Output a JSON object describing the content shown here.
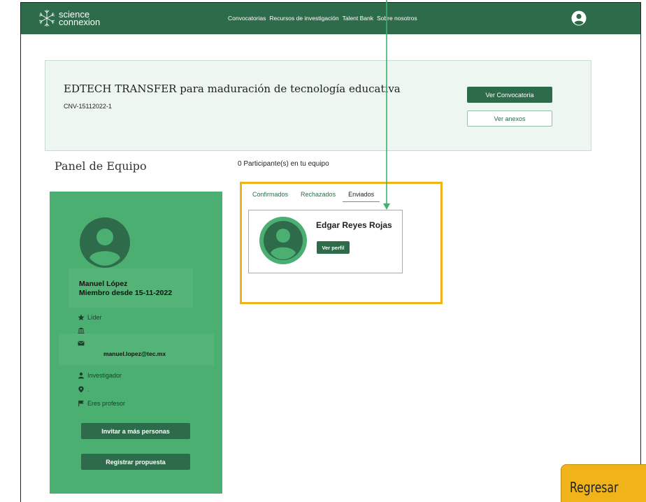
{
  "header": {
    "logo_line1": "science",
    "logo_line2": "connexion",
    "nav": [
      "Convocatorias",
      "Recursos de investigación",
      "Talent Bank",
      "Sobre nosotros"
    ]
  },
  "call": {
    "title": "EDTECH TRANSFER para maduración de tecnología educativa",
    "code": "CNV-15112022-1",
    "primary_button": "Ver Convocatoria",
    "secondary_button": "Ver anexos"
  },
  "panel": {
    "title": "Panel de Equipo",
    "participants_count": "0 Participante(s) en tu equipo"
  },
  "member": {
    "name": "Manuel López",
    "since": "Miembro desde 15-11-2022",
    "role": "Líder",
    "institution": "",
    "email": "manuel.lopez@tec.mx",
    "profile_type": "Investigador",
    "location": ".",
    "teacher": "Eres profesor",
    "invite_button": "Invitar a más personas",
    "proposal_button": "Registrar propuesta"
  },
  "tabs": [
    {
      "label": "Confirmados",
      "active": false
    },
    {
      "label": "Rechazados",
      "active": false
    },
    {
      "label": "Enviados",
      "active": true
    }
  ],
  "sent": [
    {
      "name": "Edgar Reyes Rojas",
      "button": "Ver perfil"
    }
  ],
  "overlay_button": "Regresar",
  "colors": {
    "primary": "#2e6b4b",
    "card_green": "#4caf72",
    "highlight": "#f0b41a",
    "arrow": "#3cb371"
  }
}
